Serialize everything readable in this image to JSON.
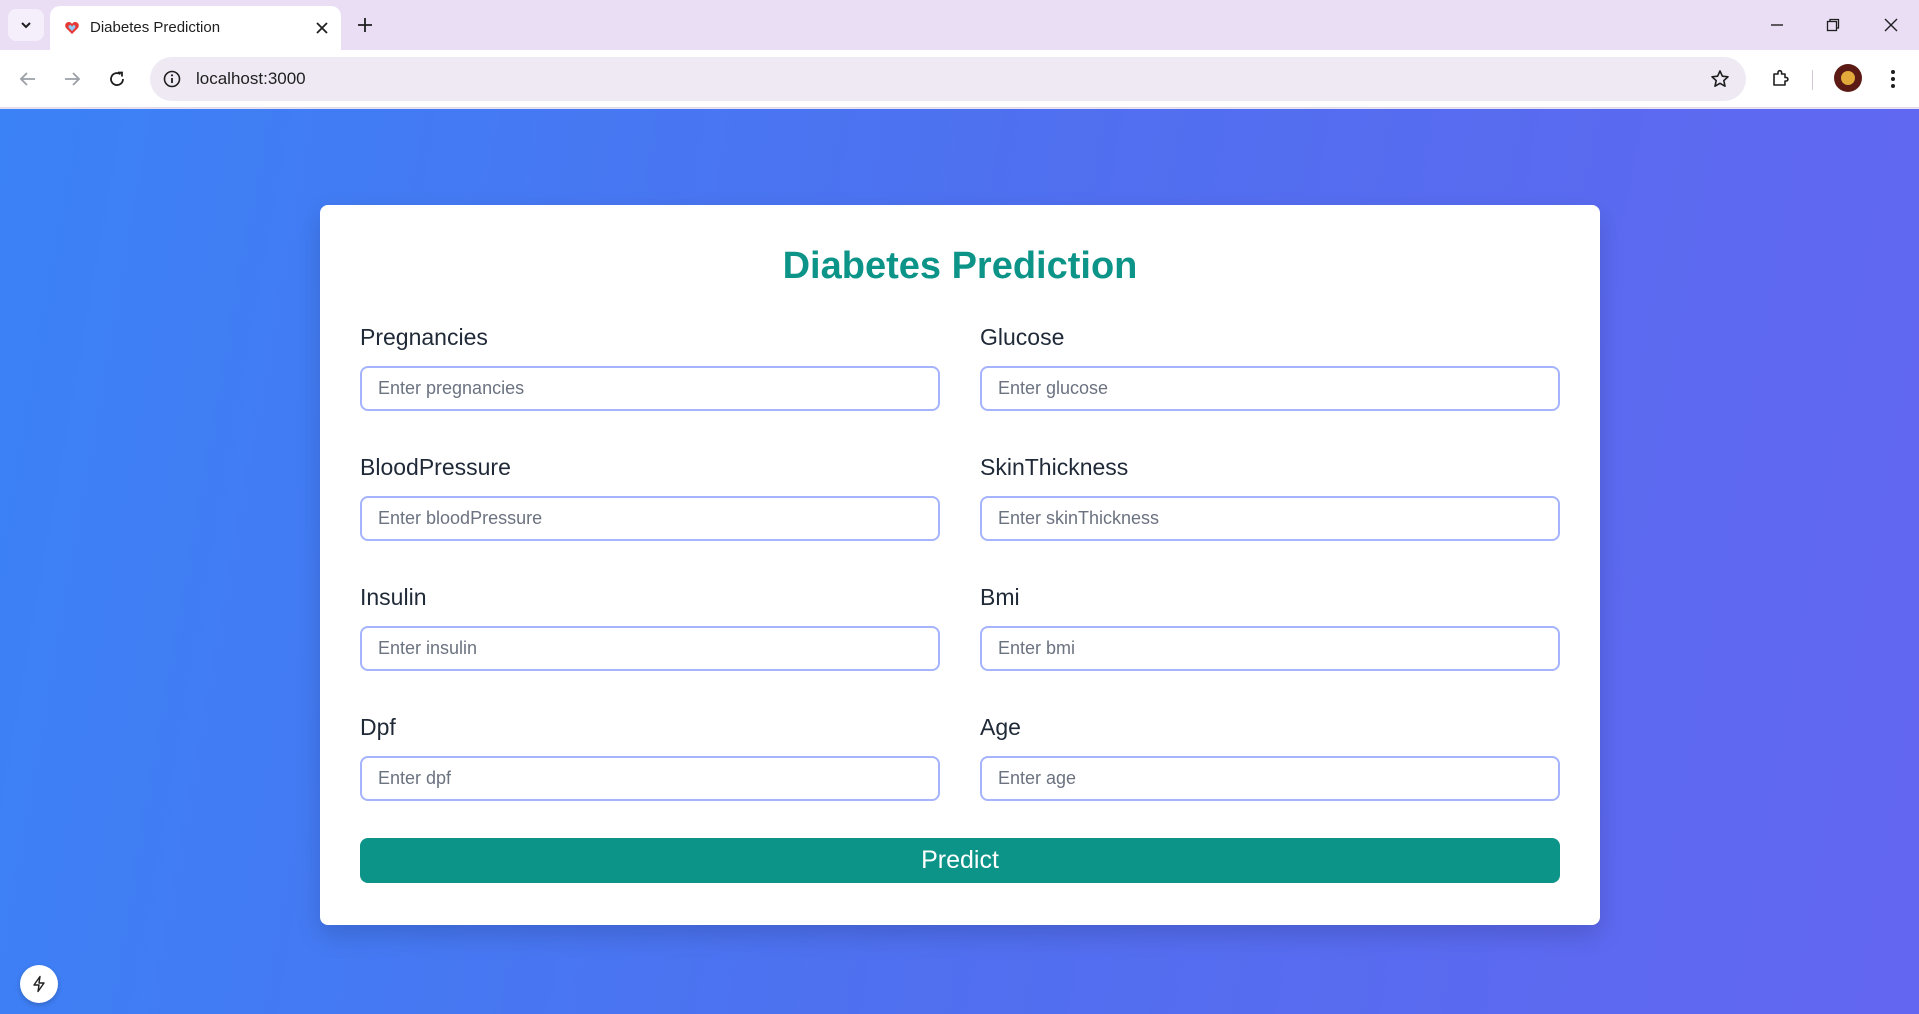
{
  "browser": {
    "tab_title": "Diabetes Prediction",
    "url": "localhost:3000",
    "icons": {
      "tab_search": "chevron-down-icon",
      "favicon": "heart-favicon-icon",
      "close_tab": "close-icon",
      "new_tab": "plus-icon",
      "minimize": "minimize-icon",
      "restore": "restore-icon",
      "close_window": "close-icon",
      "back": "arrow-left-icon",
      "forward": "arrow-right-icon",
      "reload": "reload-icon",
      "site_info": "info-icon",
      "bookmark": "star-icon",
      "extensions": "puzzle-icon",
      "profile": "avatar",
      "menu": "kebab-menu-icon"
    }
  },
  "page": {
    "title": "Diabetes Prediction",
    "fields": [
      {
        "label": "Pregnancies",
        "placeholder": "Enter pregnancies",
        "value": ""
      },
      {
        "label": "Glucose",
        "placeholder": "Enter glucose",
        "value": ""
      },
      {
        "label": "BloodPressure",
        "placeholder": "Enter bloodPressure",
        "value": ""
      },
      {
        "label": "SkinThickness",
        "placeholder": "Enter skinThickness",
        "value": ""
      },
      {
        "label": "Insulin",
        "placeholder": "Enter insulin",
        "value": ""
      },
      {
        "label": "Bmi",
        "placeholder": "Enter bmi",
        "value": ""
      },
      {
        "label": "Dpf",
        "placeholder": "Enter dpf",
        "value": ""
      },
      {
        "label": "Age",
        "placeholder": "Enter age",
        "value": ""
      }
    ],
    "submit_label": "Predict",
    "dev_indicator_icon": "lightning-icon"
  },
  "colors": {
    "accent": "#0d9488",
    "input_border": "#a5b4fc",
    "background_gradient_start": "#3b82f6",
    "background_gradient_end": "#6366f1"
  }
}
